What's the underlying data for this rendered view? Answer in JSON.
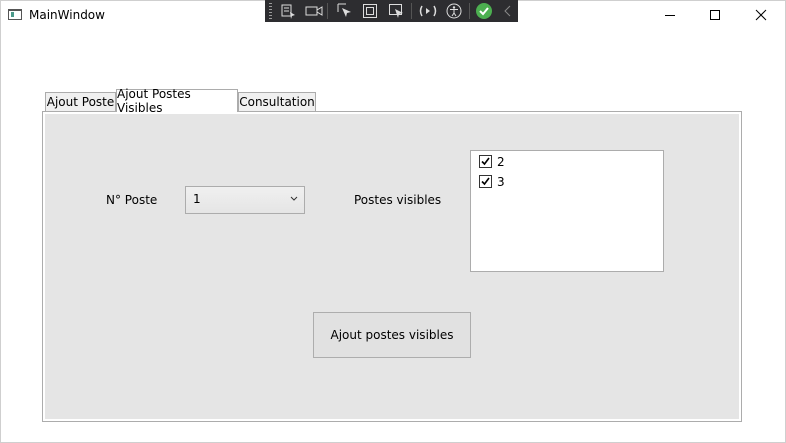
{
  "window": {
    "title": "MainWindow",
    "controls": [
      "minimize",
      "maximize",
      "close"
    ]
  },
  "debug_toolbar": {
    "icons": [
      "live-visual-tree-icon",
      "record-icon",
      "select-element-icon",
      "display-layout-adorners-icon",
      "track-focused-element-icon",
      "hot-reload-icon",
      "accessibility-icon",
      "check-icon",
      "collapse-icon"
    ],
    "accent_check": "#4caf50"
  },
  "tabs": [
    {
      "label": "Ajout Poste",
      "selected": false
    },
    {
      "label": "Ajout Postes Visibles",
      "selected": true
    },
    {
      "label": "Consultation",
      "selected": false
    }
  ],
  "form": {
    "poste_label": "N° Poste",
    "poste_value": "1",
    "visibles_label": "Postes visibles",
    "visibles_items": [
      {
        "label": "2",
        "checked": true
      },
      {
        "label": "3",
        "checked": true
      }
    ],
    "submit_label": "Ajout postes visibles"
  }
}
